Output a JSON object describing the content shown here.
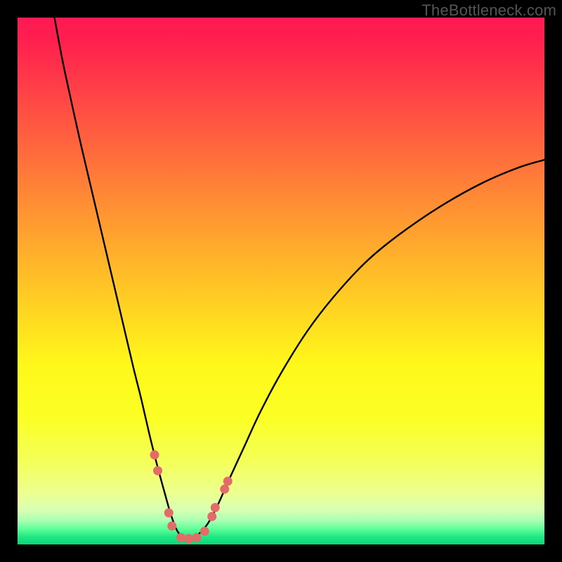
{
  "watermark": "TheBottleneck.com",
  "chart_data": {
    "type": "line",
    "title": "",
    "xlabel": "",
    "ylabel": "",
    "xlim": [
      0,
      100
    ],
    "ylim": [
      0,
      100
    ],
    "background_gradient": {
      "stops": [
        {
          "offset": 0.0,
          "color": "#ff1a52"
        },
        {
          "offset": 0.04,
          "color": "#ff1e4f"
        },
        {
          "offset": 0.14,
          "color": "#ff4146"
        },
        {
          "offset": 0.24,
          "color": "#ff653e"
        },
        {
          "offset": 0.34,
          "color": "#ff8935"
        },
        {
          "offset": 0.45,
          "color": "#ffb02b"
        },
        {
          "offset": 0.55,
          "color": "#ffd322"
        },
        {
          "offset": 0.66,
          "color": "#fff81a"
        },
        {
          "offset": 0.76,
          "color": "#fbff25"
        },
        {
          "offset": 0.84,
          "color": "#f4ff57"
        },
        {
          "offset": 0.9,
          "color": "#edff8e"
        },
        {
          "offset": 0.935,
          "color": "#d8ffb3"
        },
        {
          "offset": 0.955,
          "color": "#a7ffb2"
        },
        {
          "offset": 0.97,
          "color": "#62ff9a"
        },
        {
          "offset": 0.985,
          "color": "#22e884"
        },
        {
          "offset": 1.0,
          "color": "#06d878"
        }
      ]
    },
    "curve_color": "#000000",
    "curve_width": 2.4,
    "series": [
      {
        "name": "bottleneck-curve",
        "x": [
          7.0,
          8.5,
          10.0,
          12.0,
          14.0,
          16.0,
          18.0,
          20.0,
          22.0,
          23.5,
          25.0,
          26.5,
          28.0,
          29.0,
          30.0,
          31.0,
          32.0,
          33.0,
          34.0,
          36.0,
          38.0,
          40.0,
          43.0,
          46.0,
          50.0,
          55.0,
          60.0,
          66.0,
          72.0,
          80.0,
          88.0,
          95.0,
          100.0
        ],
        "y": [
          100.0,
          92.0,
          85.0,
          76.0,
          67.5,
          59.0,
          50.5,
          42.0,
          33.5,
          27.5,
          21.0,
          15.0,
          9.5,
          6.0,
          3.2,
          1.6,
          1.0,
          1.0,
          1.6,
          3.8,
          7.5,
          12.0,
          18.5,
          25.0,
          32.5,
          40.5,
          47.0,
          53.5,
          58.5,
          64.0,
          68.5,
          71.5,
          73.0
        ]
      }
    ],
    "markers": {
      "color": "#e26c68",
      "radius": 6.5,
      "points": [
        {
          "x": 26.0,
          "y": 17.0
        },
        {
          "x": 26.6,
          "y": 14.0
        },
        {
          "x": 28.7,
          "y": 6.0
        },
        {
          "x": 29.3,
          "y": 3.5
        },
        {
          "x": 31.0,
          "y": 1.3
        },
        {
          "x": 32.5,
          "y": 1.1
        },
        {
          "x": 34.0,
          "y": 1.3
        },
        {
          "x": 35.5,
          "y": 2.5
        },
        {
          "x": 36.9,
          "y": 5.3
        },
        {
          "x": 37.5,
          "y": 7.0
        },
        {
          "x": 39.3,
          "y": 10.5
        },
        {
          "x": 39.9,
          "y": 12.0
        }
      ]
    }
  }
}
